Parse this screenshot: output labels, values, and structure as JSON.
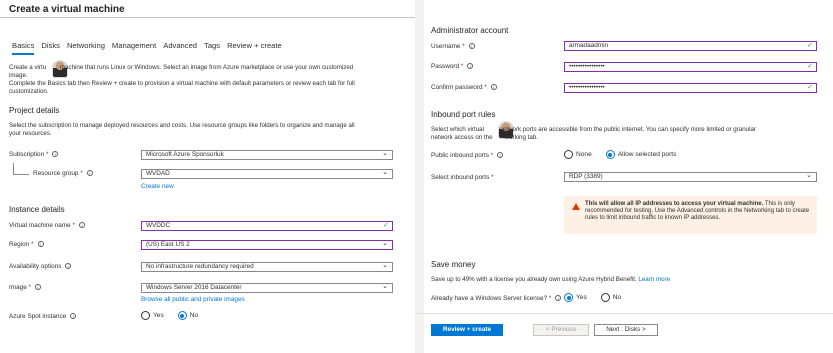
{
  "title": "Create a virtual machine",
  "tabs": [
    "Basics",
    "Disks",
    "Networking",
    "Management",
    "Advanced",
    "Tags",
    "Review + create"
  ],
  "intro": {
    "line1": "Create a virtu        machine that runs Linux or Windows. Select an image from Azure marketplace or use your own customized",
    "line2": "image.",
    "line3": "Complete the Basics tab then Review + create to provision a virtual machine with default parameters or review each tab for full",
    "line4": "customization."
  },
  "project": {
    "heading": "Project details",
    "desc1": "Select the subscription to manage deployed resources and costs. Use resource groups like folders to organize and manage all",
    "desc2": "your resources.",
    "subscription_label": "Subscription",
    "subscription_value": "Microsoft Azure Sponsorluk",
    "resource_group_label": "Resource group",
    "resource_group_value": "WVDAD",
    "create_new": "Create new"
  },
  "instance": {
    "heading": "Instance details",
    "vm_name_label": "Virtual machine name",
    "vm_name_value": "WVDDC",
    "region_label": "Region",
    "region_value": "(US) East US 2",
    "availability_label": "Availability options",
    "availability_value": "No infrastructure redundancy required",
    "image_label": "Image",
    "image_value": "Windows Server 2016 Datacenter",
    "browse_images": "Browse all public and private images",
    "spot_label": "Azure Spot instance",
    "spot_yes": "Yes",
    "spot_no": "No"
  },
  "admin": {
    "heading": "Administrator account",
    "username_label": "Username",
    "username_value": "armadaadmin",
    "password_label": "Password",
    "password_value": "••••••••••••••••",
    "confirm_label": "Confirm password",
    "confirm_value": "••••••••••••••••"
  },
  "ports": {
    "heading": "Inbound port rules",
    "desc1": "Select which virtual         network ports are accessible from the public internet. You can specify more limited or granular",
    "desc2": "network access on the       working tab.",
    "public_label": "Public inbound ports",
    "opt_none": "None",
    "opt_allow": "Allow selected ports",
    "select_label": "Select inbound ports",
    "select_value": "RDP (3389)",
    "warning_bold": "This will allow all IP addresses to access your virtual machine.",
    "warning_rest": " This is only recommended for testing. Use the Advanced controls in the Networking tab to create rules to limit inbound traffic to known IP addresses."
  },
  "savings": {
    "heading": "Save money",
    "desc": "Save up to 49% with a license you already own using Azure Hybrid Benefit.",
    "learn_more": "Learn more",
    "license_label": "Already have a Windows Server license?",
    "yes": "Yes",
    "no": "No"
  },
  "footer": {
    "review_create": "Review + create",
    "previous": "< Previous",
    "next": "Next : Disks >"
  },
  "colors": {
    "accent": "#0078d4",
    "valid_border": "#8a2da8",
    "warning_bg": "#fdf1e5",
    "required": "#a4262c"
  },
  "icons": [
    "info-icon",
    "chevron-down-icon",
    "checkmark-icon",
    "warning-icon",
    "avatar"
  ]
}
